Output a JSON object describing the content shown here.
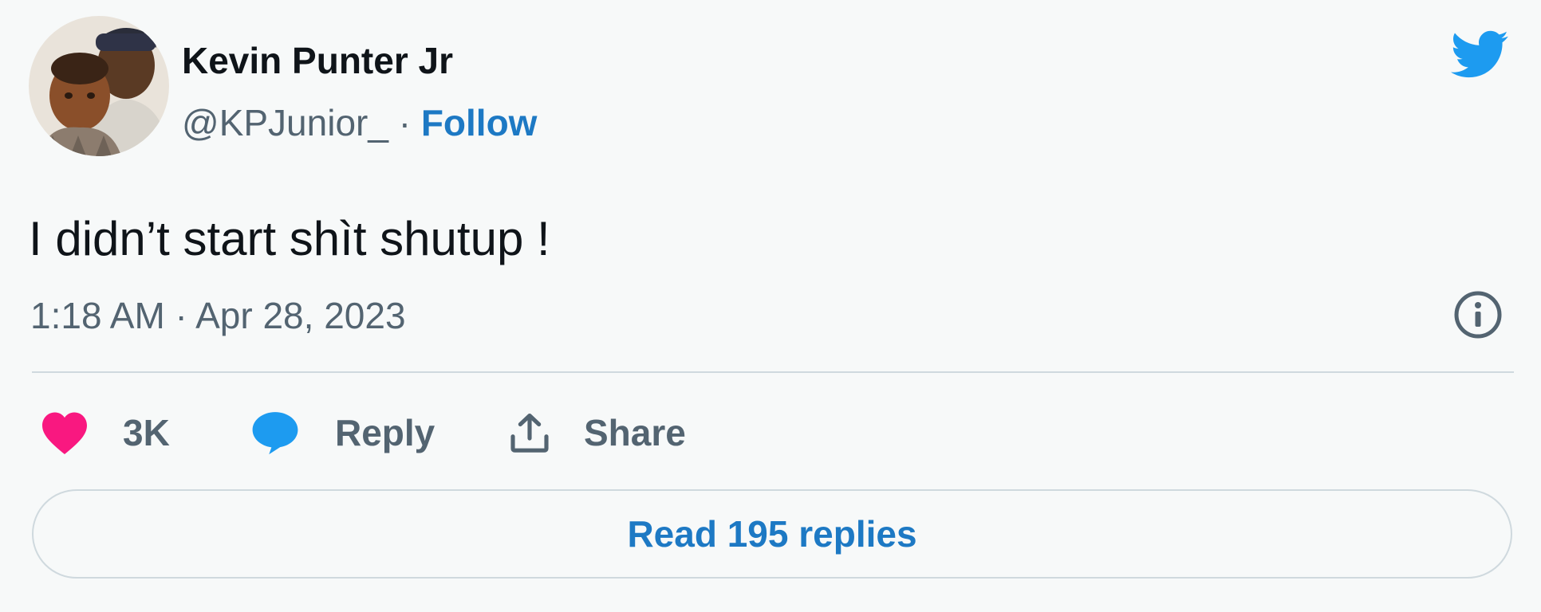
{
  "author": {
    "display_name": "Kevin Punter Jr",
    "handle": "@KPJunior_",
    "separator": " · ",
    "follow_label": "Follow"
  },
  "tweet": {
    "text": "I didn’t start shìt shutup !",
    "timestamp": "1:18 AM · Apr 28, 2023"
  },
  "actions": {
    "like_count": "3K",
    "reply_label": "Reply",
    "share_label": "Share"
  },
  "read_replies_label": "Read 195 replies",
  "icons": {
    "logo": "twitter-bird-icon",
    "info": "info-icon",
    "like": "heart-icon",
    "reply": "speech-bubble-icon",
    "share": "share-upload-icon"
  },
  "colors": {
    "twitter_blue": "#1d9bf0",
    "link_blue": "#1d79c4",
    "heart_pink": "#f91880",
    "muted_text": "#536471",
    "divider": "#cfd9de",
    "background": "#f7f9f9"
  }
}
